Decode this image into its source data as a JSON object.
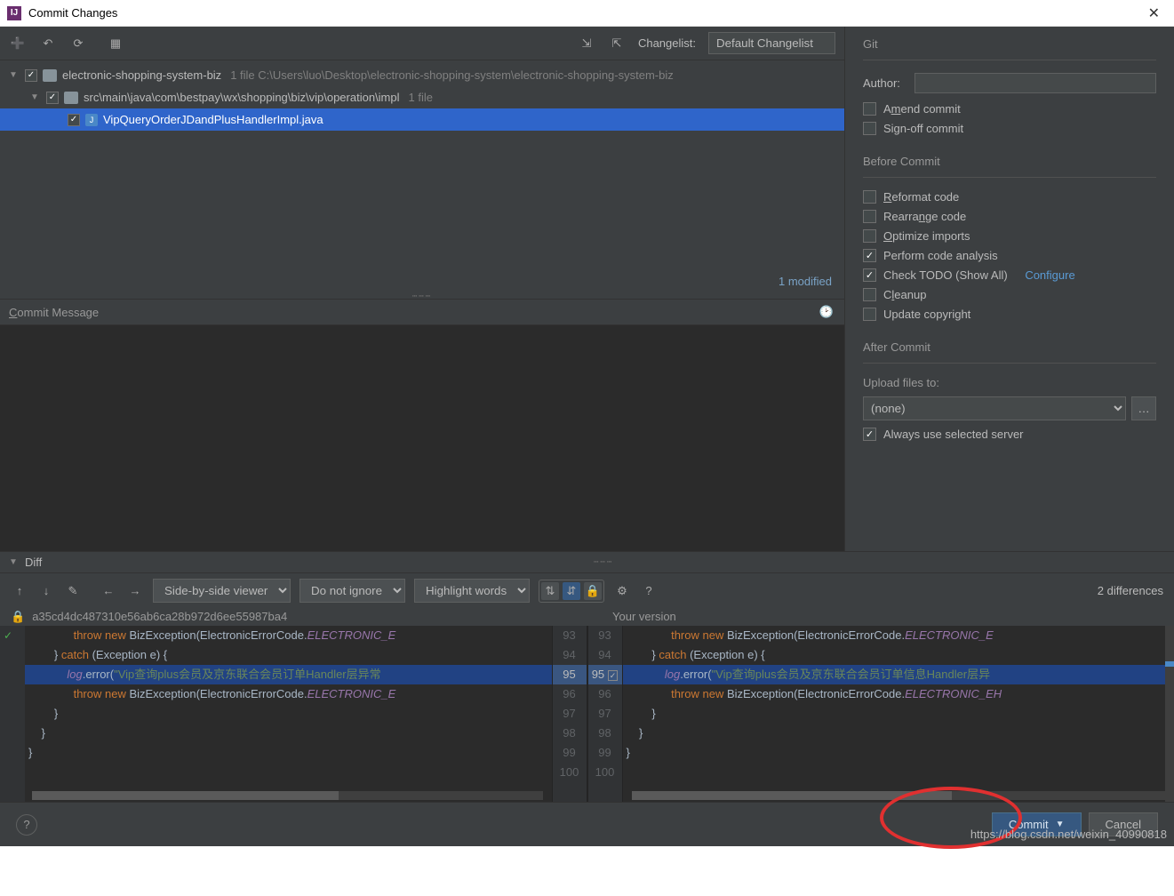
{
  "window": {
    "title": "Commit Changes"
  },
  "toolbar": {
    "changelist_label": "Changelist:",
    "changelist_value": "Default Changelist"
  },
  "tree": {
    "root": {
      "name": "electronic-shopping-system-biz",
      "meta": "1 file  C:\\Users\\luo\\Desktop\\electronic-shopping-system\\electronic-shopping-system-biz"
    },
    "pkg": {
      "name": "src\\main\\java\\com\\bestpay\\wx\\shopping\\biz\\vip\\operation\\impl",
      "meta": "1 file"
    },
    "file": {
      "name": "VipQueryOrderJDandPlusHandlerImpl.java"
    },
    "footer": "1 modified"
  },
  "commit_msg": {
    "label_pre": "C",
    "label_rest": "ommit Message"
  },
  "git": {
    "section": "Git",
    "author_label_pre": "A",
    "author_label_rest": "uthor:",
    "amend_pre": "A",
    "amend_mid": "m",
    "amend_rest": "end commit",
    "signoff": "Sign-off commit"
  },
  "before": {
    "section": "Before Commit",
    "reformat_pre": "R",
    "reformat_rest": "eformat code",
    "rearrange_pre": "Rearra",
    "rearrange_u": "n",
    "rearrange_rest": "ge code",
    "optimize_pre": "O",
    "optimize_rest": "ptimize imports",
    "perform": "Perform code analysis",
    "todo": "Check TODO (Show All)",
    "configure": "Configure",
    "cleanup_pre": "C",
    "cleanup_u": "l",
    "cleanup_rest": "eanup",
    "copyright": "Update copyright"
  },
  "after": {
    "section": "After Commit",
    "upload_label": "Upload files to:",
    "upload_value": "(none)",
    "always": "Always use selected server"
  },
  "diff": {
    "section_pre": "D",
    "section_rest": "iff",
    "viewer_value": "Side-by-side viewer",
    "ignore_value": "Do not ignore",
    "highlight_value": "Highlight words",
    "differences": "2 differences",
    "commit_hash": "a35cd4dc487310e56ab6ca28b972d6ee55987ba4",
    "right_label": "Your version",
    "line_nums_left": [
      "93",
      "94",
      "95",
      "96",
      "97",
      "98",
      "99",
      "100"
    ],
    "line_nums_right": [
      "93",
      "94",
      "95",
      "96",
      "97",
      "98",
      "99",
      "100"
    ],
    "left_lines": [
      {
        "indent": 14,
        "parts": [
          {
            "t": "throw new ",
            "c": "kw"
          },
          {
            "t": "BizException(ElectronicErrorCode.",
            "c": "typ"
          },
          {
            "t": "ELECTRONIC_E",
            "c": "idt"
          }
        ]
      },
      {
        "indent": 8,
        "parts": [
          {
            "t": "} ",
            "c": "typ"
          },
          {
            "t": "catch ",
            "c": "kw"
          },
          {
            "t": "(Exception e) {",
            "c": "typ"
          }
        ]
      },
      {
        "hl": true,
        "indent": 12,
        "parts": [
          {
            "t": "log",
            "c": "idt"
          },
          {
            "t": ".error(",
            "c": "typ"
          },
          {
            "t": "\"Vip查询plus会员及京东联合会员订单Handler层异常",
            "c": "str"
          }
        ]
      },
      {
        "indent": 14,
        "parts": [
          {
            "t": "throw new ",
            "c": "kw"
          },
          {
            "t": "BizException(ElectronicErrorCode.",
            "c": "typ"
          },
          {
            "t": "ELECTRONIC_E",
            "c": "idt"
          }
        ]
      },
      {
        "indent": 8,
        "parts": [
          {
            "t": "}",
            "c": "typ"
          }
        ]
      },
      {
        "indent": 4,
        "parts": [
          {
            "t": "}",
            "c": "typ"
          }
        ]
      },
      {
        "indent": 0,
        "parts": [
          {
            "t": "}",
            "c": "typ"
          }
        ]
      },
      {
        "indent": 0,
        "parts": [
          {
            "t": "",
            "c": "typ"
          }
        ]
      }
    ],
    "right_lines": [
      {
        "indent": 14,
        "parts": [
          {
            "t": "throw new ",
            "c": "kw"
          },
          {
            "t": "BizException(ElectronicErrorCode.",
            "c": "typ"
          },
          {
            "t": "ELECTRONIC_E",
            "c": "idt"
          }
        ]
      },
      {
        "indent": 8,
        "parts": [
          {
            "t": "} ",
            "c": "typ"
          },
          {
            "t": "catch ",
            "c": "kw"
          },
          {
            "t": "(Exception e) {",
            "c": "typ"
          }
        ]
      },
      {
        "hl": true,
        "indent": 12,
        "parts": [
          {
            "t": "log",
            "c": "idt"
          },
          {
            "t": ".error(",
            "c": "typ"
          },
          {
            "t": "\"Vip查询plus会员及京东联合会员订单信息Handler层异",
            "c": "str"
          }
        ]
      },
      {
        "indent": 14,
        "parts": [
          {
            "t": "throw new ",
            "c": "kw"
          },
          {
            "t": "BizException(ElectronicErrorCode.",
            "c": "typ"
          },
          {
            "t": "ELECTRONIC_EH",
            "c": "idt"
          }
        ]
      },
      {
        "indent": 8,
        "parts": [
          {
            "t": "}",
            "c": "typ"
          }
        ]
      },
      {
        "indent": 4,
        "parts": [
          {
            "t": "}",
            "c": "typ"
          }
        ]
      },
      {
        "indent": 0,
        "parts": [
          {
            "t": "}",
            "c": "typ"
          }
        ]
      },
      {
        "indent": 0,
        "parts": [
          {
            "t": "",
            "c": "typ"
          }
        ]
      }
    ]
  },
  "buttons": {
    "help": "?",
    "commit": "Commit",
    "cancel": "Cancel"
  },
  "watermark": "https://blog.csdn.net/weixin_40990818"
}
